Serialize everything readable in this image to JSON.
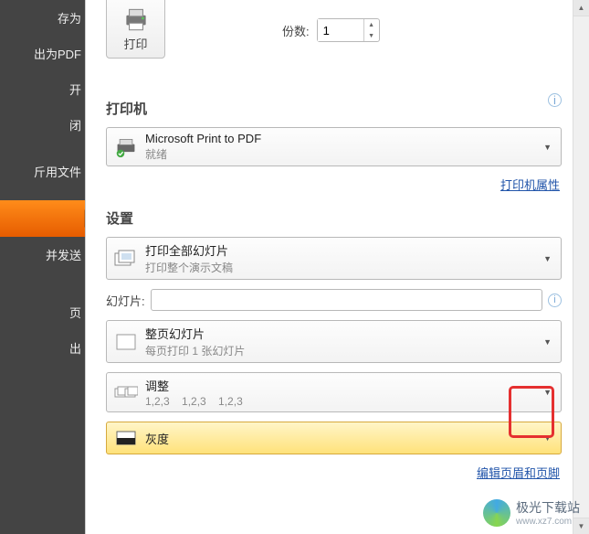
{
  "sidebar": {
    "items": [
      {
        "label": "存为"
      },
      {
        "label": "出为PDF"
      },
      {
        "label": "开"
      },
      {
        "label": "闭"
      },
      {
        "label": "斤用文件"
      },
      {
        "label": ""
      },
      {
        "label": "并发送"
      },
      {
        "label": "页"
      },
      {
        "label": "出"
      }
    ]
  },
  "print_button": {
    "label": "打印"
  },
  "copies": {
    "label": "份数:",
    "value": "1"
  },
  "printer": {
    "section": "打印机",
    "name": "Microsoft Print to PDF",
    "status": "就绪",
    "properties_link": "打印机属性"
  },
  "settings": {
    "section": "设置",
    "print_all": {
      "title": "打印全部幻灯片",
      "sub": "打印整个演示文稿"
    },
    "slides_label": "幻灯片:",
    "full_page": {
      "title": "整页幻灯片",
      "sub": "每页打印 1 张幻灯片"
    },
    "collate": {
      "title": "调整",
      "sub": "1,2,3    1,2,3    1,2,3"
    },
    "grayscale": {
      "title": "灰度"
    },
    "edit_header_link": "编辑页眉和页脚"
  },
  "watermark": {
    "text": "极光下载站",
    "url": "www.xz7.com"
  }
}
